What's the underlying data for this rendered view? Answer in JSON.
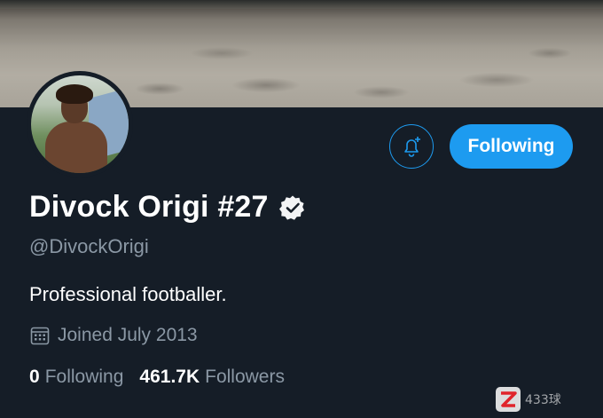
{
  "profile": {
    "name": "Divock Origi #27",
    "handle": "@DivockOrigi",
    "bio": "Professional footballer.",
    "joined": "Joined July 2013"
  },
  "actions": {
    "follow_label": "Following",
    "notify_icon": "bell-plus-icon"
  },
  "stats": [
    {
      "value": "0",
      "label": "Following"
    },
    {
      "value": "461.7K",
      "label": "Followers"
    }
  ],
  "icons": {
    "verified": "verified-badge-icon",
    "calendar": "calendar-icon"
  },
  "watermark": {
    "text": "433球"
  },
  "colors": {
    "background": "#151d27",
    "accent": "#1d9bf0",
    "secondary_text": "#8b98a5"
  }
}
